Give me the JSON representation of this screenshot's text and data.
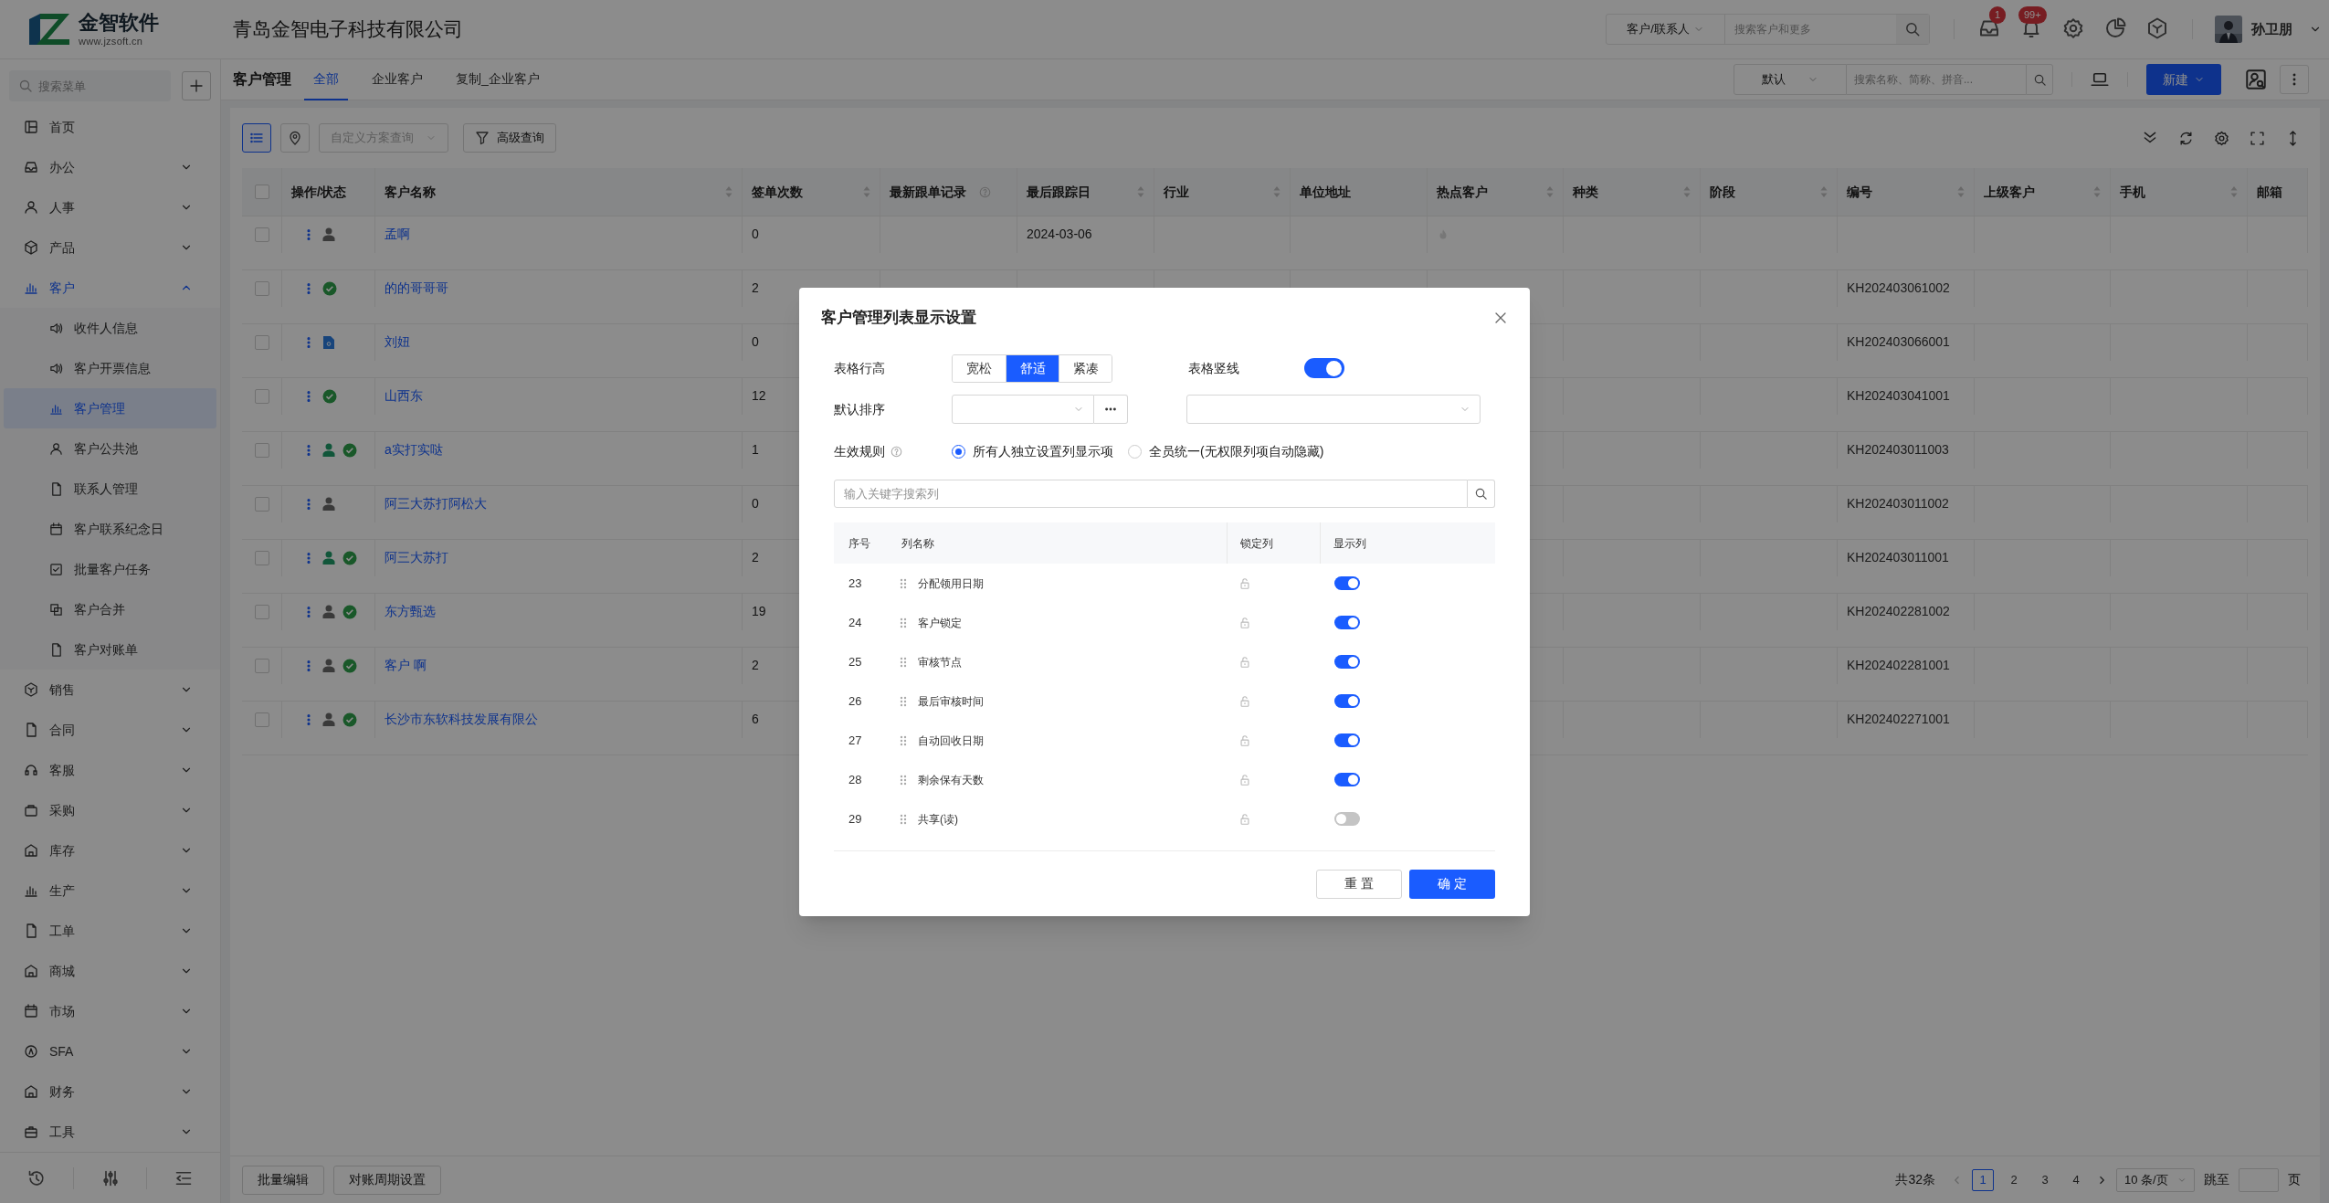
{
  "app": {
    "logo_name": "金智软件",
    "logo_url": "www.jzsoft.cn",
    "company": "青岛金智电子科技有限公司"
  },
  "top_bar": {
    "search_scope": "客户/联系人",
    "search_placeholder": "搜索客户和更多",
    "badges": [
      "1",
      "99+"
    ],
    "user": "孙卫朋"
  },
  "sidebar": {
    "search_placeholder": "搜索菜单",
    "items": [
      {
        "label": "首页",
        "selected": false
      },
      {
        "label": "办公",
        "selected": false,
        "expanded": false
      },
      {
        "label": "人事",
        "selected": false,
        "expanded": false
      },
      {
        "label": "产品",
        "selected": false,
        "expanded": false
      },
      {
        "label": "客户",
        "selected": true,
        "expanded": true,
        "children": [
          {
            "label": "收件人信息",
            "selected": false
          },
          {
            "label": "客户开票信息",
            "selected": false
          },
          {
            "label": "客户管理",
            "selected": true
          },
          {
            "label": "客户公共池",
            "selected": false
          },
          {
            "label": "联系人管理",
            "selected": false
          },
          {
            "label": "客户联系纪念日",
            "selected": false
          },
          {
            "label": "批量客户任务",
            "selected": false
          },
          {
            "label": "客户合并",
            "selected": false
          },
          {
            "label": "客户对账单",
            "selected": false
          }
        ]
      },
      {
        "label": "销售",
        "selected": false,
        "expanded": false
      },
      {
        "label": "合同",
        "selected": false,
        "expanded": false
      },
      {
        "label": "客服",
        "selected": false,
        "expanded": false
      },
      {
        "label": "采购",
        "selected": false,
        "expanded": false
      },
      {
        "label": "库存",
        "selected": false,
        "expanded": false
      },
      {
        "label": "生产",
        "selected": false,
        "expanded": false
      },
      {
        "label": "工单",
        "selected": false,
        "expanded": false
      },
      {
        "label": "商城",
        "selected": false,
        "expanded": false
      },
      {
        "label": "市场",
        "selected": false,
        "expanded": false
      },
      {
        "label": "SFA",
        "selected": false,
        "expanded": false
      },
      {
        "label": "财务",
        "selected": false,
        "expanded": false
      },
      {
        "label": "工具",
        "selected": false,
        "expanded": false
      }
    ]
  },
  "page_header": {
    "title": "客户管理",
    "tabs": [
      {
        "label": "全部",
        "selected": true
      },
      {
        "label": "企业客户",
        "selected": false
      },
      {
        "label": "复制_企业客户",
        "selected": false
      }
    ],
    "view_select": "默认",
    "search_placeholder": "搜索名称、简称、拼音...",
    "new_button": "新建"
  },
  "toolbar": {
    "views": [
      {
        "kind": "list",
        "selected": true
      },
      {
        "kind": "map",
        "selected": false
      }
    ],
    "scheme_placeholder": "自定义方案查询",
    "advanced_button": "高级查询"
  },
  "table": {
    "select_all_checked": false,
    "columns": [
      {
        "label": "操作/状态",
        "sortable": false
      },
      {
        "label": "客户名称",
        "sortable": true
      },
      {
        "label": "签单次数",
        "sortable": true
      },
      {
        "label": "最新跟单记录",
        "sortable": false,
        "help": true
      },
      {
        "label": "最后跟踪日",
        "sortable": true
      },
      {
        "label": "行业",
        "sortable": true
      },
      {
        "label": "单位地址",
        "sortable": false
      },
      {
        "label": "热点客户",
        "sortable": true
      },
      {
        "label": "种类",
        "sortable": true
      },
      {
        "label": "阶段",
        "sortable": true
      },
      {
        "label": "编号",
        "sortable": true
      },
      {
        "label": "上级客户",
        "sortable": true
      },
      {
        "label": "手机",
        "sortable": true
      },
      {
        "label": "邮箱",
        "sortable": false
      }
    ],
    "rows": [
      {
        "checked": false,
        "status": [
          {
            "kind": "person",
            "assigned": false
          }
        ],
        "name": "孟啊",
        "count": "0",
        "last_date": "2024-03-06",
        "hot": false
      },
      {
        "checked": false,
        "status": [
          {
            "kind": "check"
          }
        ],
        "name": "的的哥哥哥",
        "count": "2",
        "code": "KH202403061002"
      },
      {
        "checked": false,
        "status": [
          {
            "kind": "file"
          }
        ],
        "name": "刘妞",
        "count": "0",
        "code": "KH202403066001"
      },
      {
        "checked": false,
        "status": [
          {
            "kind": "check"
          }
        ],
        "name": "山西东",
        "count": "12",
        "code": "KH202403041001"
      },
      {
        "checked": false,
        "status": [
          {
            "kind": "person",
            "assigned": true
          },
          {
            "kind": "check"
          }
        ],
        "name": "a实打实哒",
        "count": "1",
        "code": "KH202403011003"
      },
      {
        "checked": false,
        "status": [
          {
            "kind": "person",
            "assigned": false
          }
        ],
        "name": "阿三大苏打阿松大",
        "count": "0",
        "code": "KH202403011002"
      },
      {
        "checked": false,
        "status": [
          {
            "kind": "person",
            "assigned": true
          },
          {
            "kind": "check"
          }
        ],
        "name": "阿三大苏打",
        "count": "2",
        "code": "KH202403011001"
      },
      {
        "checked": false,
        "status": [
          {
            "kind": "person",
            "assigned": false
          },
          {
            "kind": "check"
          }
        ],
        "name": "东方甄选",
        "count": "19",
        "code": "KH202402281002"
      },
      {
        "checked": false,
        "status": [
          {
            "kind": "person",
            "assigned": false
          },
          {
            "kind": "check"
          }
        ],
        "name": "客户 啊",
        "count": "2",
        "code": "KH202402281001"
      },
      {
        "checked": false,
        "status": [
          {
            "kind": "person",
            "assigned": false
          },
          {
            "kind": "check"
          }
        ],
        "name": "长沙市东软科技发展有限公",
        "count": "6",
        "code": "KH202402271001"
      }
    ]
  },
  "footer": {
    "buttons": [
      "批量编辑",
      "对账周期设置"
    ],
    "total": "共32条",
    "pages": [
      {
        "label": "1",
        "selected": true
      },
      {
        "label": "2",
        "selected": false
      },
      {
        "label": "3",
        "selected": false
      },
      {
        "label": "4",
        "selected": false
      }
    ],
    "page_size": "10 条/页",
    "jump_label": "跳至",
    "page_label": "页"
  },
  "modal": {
    "title": "客户管理列表显示设置",
    "row_height": {
      "label": "表格行高",
      "options": [
        {
          "label": "宽松",
          "selected": false
        },
        {
          "label": "舒适",
          "selected": true
        },
        {
          "label": "紧凑",
          "selected": false
        }
      ]
    },
    "vertical_lines": {
      "label": "表格竖线",
      "on": true
    },
    "default_sort": {
      "label": "默认排序"
    },
    "rule": {
      "label": "生效规则",
      "options": [
        {
          "label": "所有人独立设置列显示项",
          "selected": true
        },
        {
          "label": "全员统一(无权限列项自动隐藏)",
          "selected": false
        }
      ]
    },
    "search_placeholder": "输入关键字搜索列",
    "list_columns": [
      "序号",
      "列名称",
      "锁定列",
      "显示列"
    ],
    "list_rows": [
      {
        "index": "23",
        "name": "分配领用日期",
        "locked": false,
        "shown": true
      },
      {
        "index": "24",
        "name": "客户锁定",
        "locked": false,
        "shown": true
      },
      {
        "index": "25",
        "name": "审核节点",
        "locked": false,
        "shown": true
      },
      {
        "index": "26",
        "name": "最后审核时间",
        "locked": false,
        "shown": true
      },
      {
        "index": "27",
        "name": "自动回收日期",
        "locked": false,
        "shown": true
      },
      {
        "index": "28",
        "name": "剩余保有天数",
        "locked": false,
        "shown": true
      },
      {
        "index": "29",
        "name": "共享(读)",
        "locked": false,
        "shown": false
      }
    ],
    "buttons": [
      "重 置",
      "确 定"
    ]
  }
}
